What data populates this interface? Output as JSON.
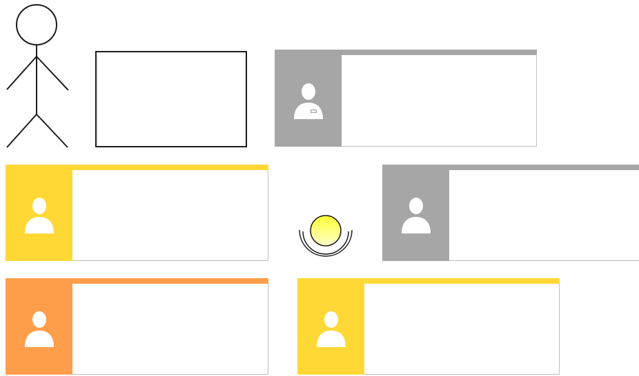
{
  "diagram": {
    "actor": {
      "icon": "stick-figure-icon"
    },
    "plain_rectangle": {},
    "cards": [
      {
        "id": "card-1",
        "color": "#a6a6a6",
        "icon": "employee-badge-icon"
      },
      {
        "id": "card-2",
        "color": "#ffd835",
        "icon": "person-icon"
      },
      {
        "id": "card-3",
        "color": "#a6a6a6",
        "icon": "person-icon"
      },
      {
        "id": "card-4",
        "color": "#ff9e4a",
        "icon": "person-icon"
      },
      {
        "id": "card-5",
        "color": "#ffd835",
        "icon": "person-icon"
      }
    ],
    "entity": {
      "icon": "entity-circle-icon",
      "color": "#ffff33"
    }
  }
}
